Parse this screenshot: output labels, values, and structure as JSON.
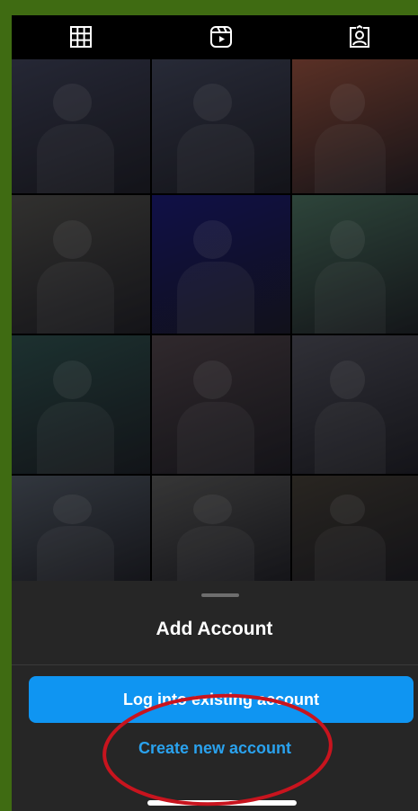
{
  "profile_tabs": [
    {
      "name": "grid-icon"
    },
    {
      "name": "reels-icon"
    },
    {
      "name": "tagged-icon"
    }
  ],
  "photos": [
    {
      "name": "photo-scouts-outdoors",
      "color": "#3a3d52"
    },
    {
      "name": "photo-scout-walking",
      "color": "#3d4155"
    },
    {
      "name": "photo-toy-jeep-ride",
      "color": "#8a4a3a"
    },
    {
      "name": "photo-car-selfie",
      "color": "#4c4b48"
    },
    {
      "name": "photo-aquarium-jellyfish",
      "color": "#1a1a6e"
    },
    {
      "name": "photo-girls-model-display",
      "color": "#466a5a"
    },
    {
      "name": "photo-aquarium-tank",
      "color": "#2c4c4a"
    },
    {
      "name": "photo-family-store",
      "color": "#4a3f45"
    },
    {
      "name": "photo-scouts-checkered",
      "color": "#4a4a55"
    },
    {
      "name": "photo-scout-leader",
      "color": "#4d5560"
    },
    {
      "name": "photo-pinewood-car",
      "color": "#545454"
    },
    {
      "name": "photo-group-statue",
      "color": "#3f3a33"
    }
  ],
  "sheet": {
    "title": "Add Account",
    "login_label": "Log into existing account",
    "create_label": "Create new account"
  },
  "colors": {
    "background": "#3f6b12",
    "sheet": "#262626",
    "primary_button": "#0f95f2",
    "link": "#2aa2ee",
    "annotation": "#c8141e"
  }
}
